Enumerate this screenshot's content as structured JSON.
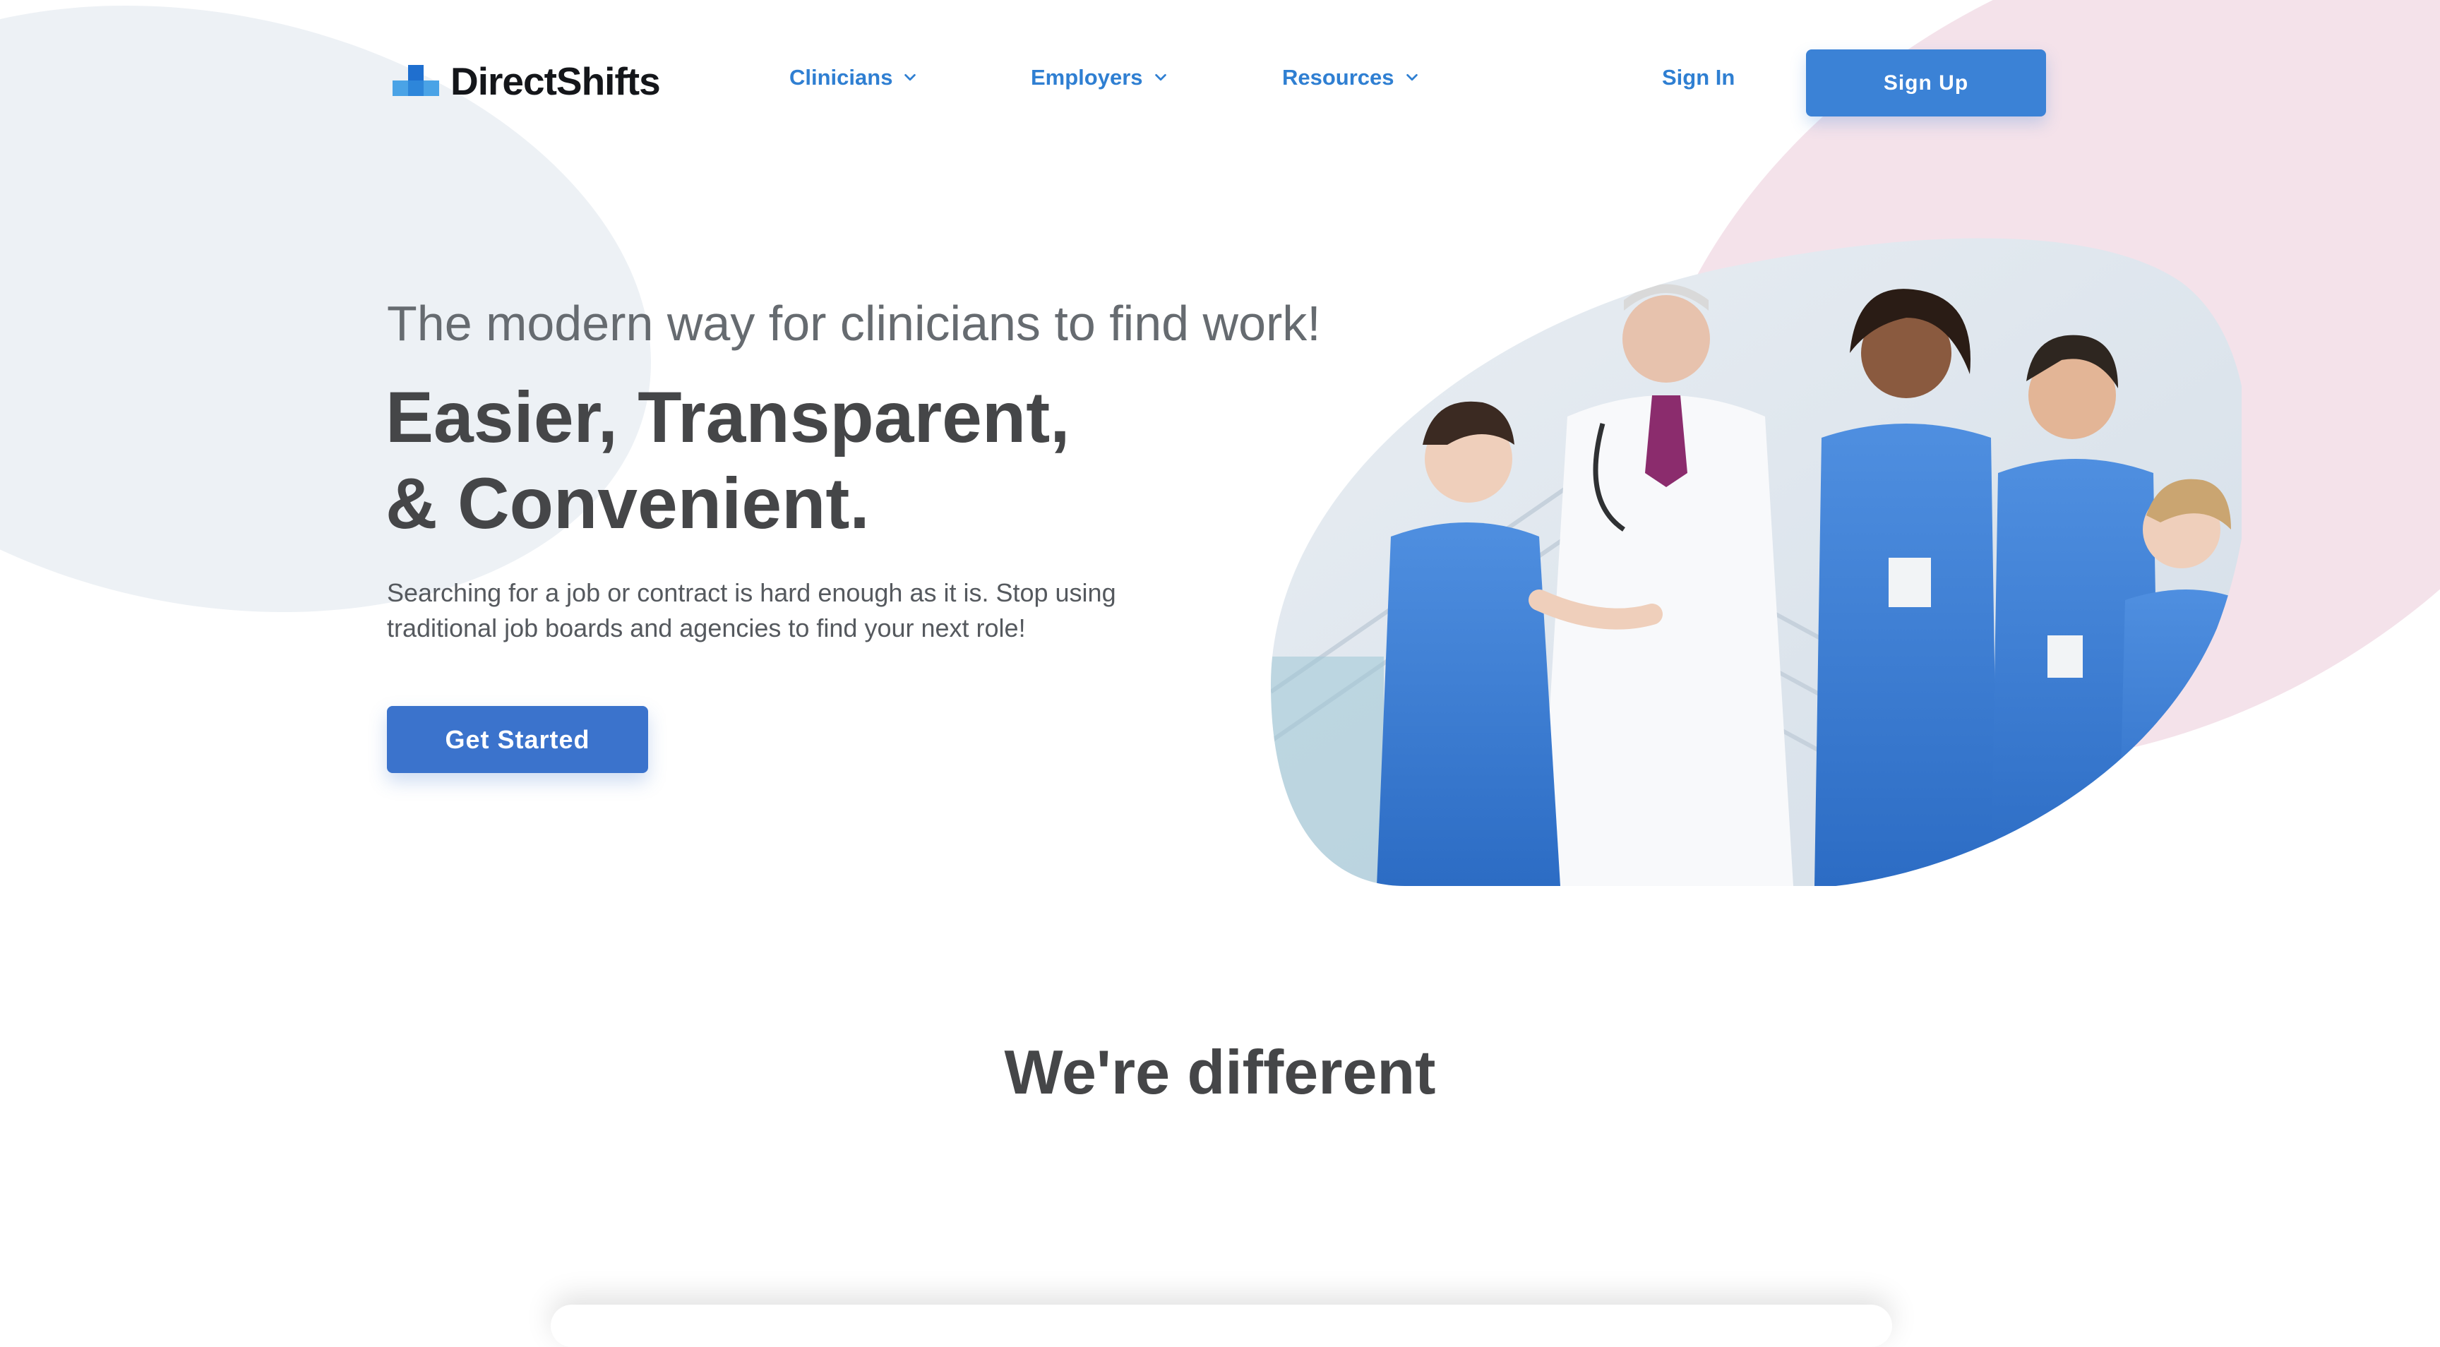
{
  "brand": {
    "name": "DirectShifts"
  },
  "nav": {
    "items": [
      {
        "label": "Clinicians",
        "icon": "chevron-down-icon"
      },
      {
        "label": "Employers",
        "icon": "chevron-down-icon"
      },
      {
        "label": "Resources",
        "icon": "chevron-down-icon"
      }
    ],
    "signin_label": "Sign In",
    "signup_label": "Sign Up"
  },
  "hero": {
    "tagline": "The modern way for clinicians to find work!",
    "headline_line1": "Easier, Transparent,",
    "headline_line2": "& Convenient.",
    "description": "Searching for a job or contract is hard enough as it is. Stop using traditional job boards and agencies to find your next role!",
    "cta_label": "Get Started",
    "image": "clinicians-team-photo"
  },
  "section": {
    "title": "We're different"
  },
  "colors": {
    "accent": "#3b82d6",
    "cta": "#3b73cc",
    "nav_link": "#2f7fd2",
    "heading": "#454648",
    "blob_gray": "#edf1f5",
    "blob_pink": "#f4e2ea"
  }
}
